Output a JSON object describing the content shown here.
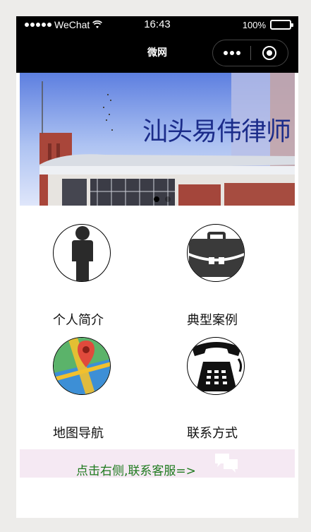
{
  "status_bar": {
    "carrier": "WeChat",
    "time": "16:43",
    "battery_text": "100%"
  },
  "nav": {
    "title": "微网"
  },
  "banner": {
    "caption": "汕头易伟律师",
    "slide_count": 2,
    "active_slide": 0
  },
  "menu": [
    {
      "label": "个人简介",
      "icon": "person-icon"
    },
    {
      "label": "典型案例",
      "icon": "briefcase-icon"
    },
    {
      "label": "地图导航",
      "icon": "map-icon"
    },
    {
      "label": "联系方式",
      "icon": "telephone-icon"
    }
  ],
  "footer": {
    "text": "点击右侧,联系客服=>",
    "icon": "chat-bubbles-icon"
  },
  "colors": {
    "nav_bg": "#000000",
    "footer_bg": "#f5e9f3",
    "footer_text": "#1e7a1e",
    "banner_caption": "#1b2c8a"
  }
}
